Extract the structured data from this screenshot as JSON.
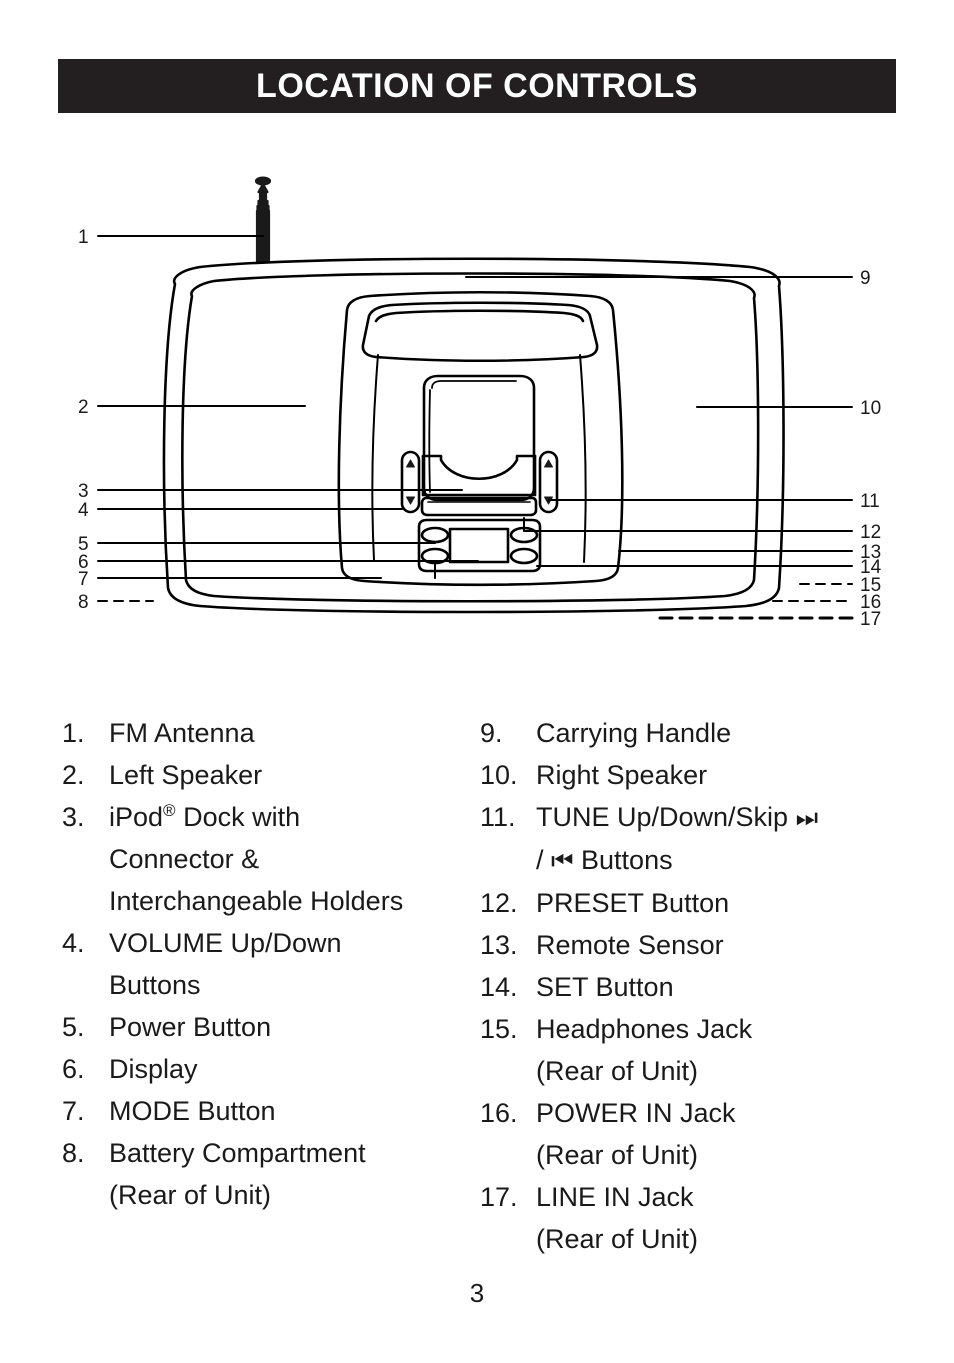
{
  "header": {
    "title": "LOCATION OF CONTROLS"
  },
  "diagram": {
    "alt_name": "portable iPod dock radio front view with numbered callouts",
    "callout_numbers_left": [
      "1",
      "2",
      "3",
      "4",
      "5",
      "6",
      "7",
      "8"
    ],
    "callout_numbers_right": [
      "9",
      "10",
      "11",
      "12",
      "13",
      "14",
      "15",
      "16",
      "17"
    ]
  },
  "legend": {
    "left": [
      {
        "num": "1.",
        "text": "FM Antenna"
      },
      {
        "num": "2.",
        "text": "Left Speaker"
      },
      {
        "num": "3.",
        "text": "iPod",
        "sup": "®",
        "text_after": " Dock with",
        "cont": [
          "Connector &",
          "Interchangeable Holders"
        ]
      },
      {
        "num": "4.",
        "text": "VOLUME Up/Down",
        "cont": [
          "Buttons"
        ]
      },
      {
        "num": "5.",
        "text": "Power Button"
      },
      {
        "num": "6.",
        "text": "Display"
      },
      {
        "num": "7.",
        "text": "MODE Button"
      },
      {
        "num": "8.",
        "text": "Battery Compartment",
        "cont": [
          "(Rear of Unit)"
        ]
      }
    ],
    "right": [
      {
        "num": "9.",
        "text": "Carrying Handle"
      },
      {
        "num": "10.",
        "text": "Right Speaker"
      },
      {
        "num": "11.",
        "text": "TUNE Up/Down/Skip ",
        "glyph1": "⏭",
        "cont_glyph": {
          "prefix": "/ ",
          "glyph": "⏮",
          "suffix": " Buttons"
        }
      },
      {
        "num": "12.",
        "text": "PRESET Button"
      },
      {
        "num": "13.",
        "text": "Remote Sensor"
      },
      {
        "num": "14.",
        "text": "SET Button"
      },
      {
        "num": "15.",
        "text": "Headphones Jack",
        "cont": [
          "(Rear of Unit)"
        ]
      },
      {
        "num": "16.",
        "text": "POWER IN Jack",
        "cont": [
          "(Rear of Unit)"
        ]
      },
      {
        "num": "17.",
        "text": "LINE IN Jack",
        "cont": [
          "(Rear of Unit)"
        ]
      }
    ]
  },
  "footer": {
    "page_number": "3"
  },
  "colors": {
    "header_bg": "#231f20",
    "header_text": "#ffffff",
    "body_text": "#1a1a1a",
    "line": "#000000"
  }
}
